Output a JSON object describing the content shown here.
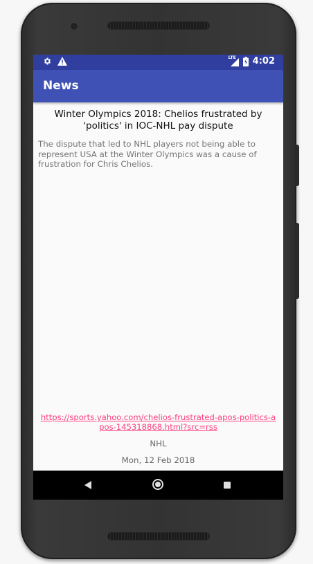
{
  "status_bar": {
    "icons_left": [
      "settings-icon",
      "warning-icon"
    ],
    "network_label": "LTE",
    "time": "4:02"
  },
  "app_bar": {
    "title": "News"
  },
  "article": {
    "title": "Winter Olympics 2018: Chelios frustrated by 'politics' in IOC-NHL pay dispute",
    "summary": "The dispute that led to NHL players not being able to represent USA at the Winter Olympics was a cause of frustration for Chris Chelios.",
    "link": "https://sports.yahoo.com/chelios-frustrated-apos-politics-apos-145318868.html?src=rss",
    "category": "NHL",
    "date": "Mon, 12 Feb 2018"
  },
  "colors": {
    "status_bar": "#303f9f",
    "app_bar": "#3f51b5",
    "link": "#ff4081"
  }
}
